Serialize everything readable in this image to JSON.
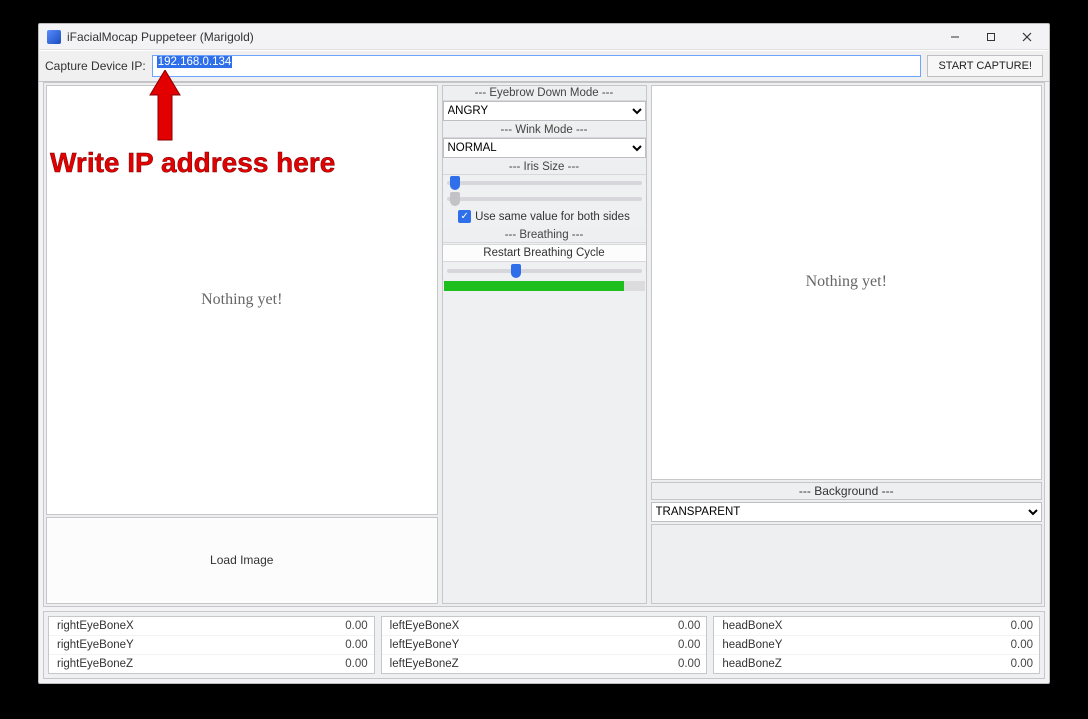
{
  "window": {
    "title": "iFacialMocap Puppeteer (Marigold)"
  },
  "toolbar": {
    "ip_label": "Capture Device IP:",
    "ip_value": "192.168.0.134",
    "start_label": "START CAPTURE!"
  },
  "mid": {
    "eyebrow_label": "--- Eyebrow Down Mode ---",
    "eyebrow_value": "ANGRY",
    "wink_label": "--- Wink Mode ---",
    "wink_value": "NORMAL",
    "iris_label": "--- Iris Size ---",
    "same_value_label": "Use same value for both sides",
    "breathing_label": "--- Breathing ---",
    "restart_label": "Restart Breathing Cycle"
  },
  "panels": {
    "left_preview": "Nothing yet!",
    "right_preview": "Nothing yet!",
    "load_image": "Load Image",
    "background_label": "--- Background ---",
    "background_value": "TRANSPARENT"
  },
  "bones": {
    "col1": [
      {
        "name": "rightEyeBoneX",
        "value": "0.00"
      },
      {
        "name": "rightEyeBoneY",
        "value": "0.00"
      },
      {
        "name": "rightEyeBoneZ",
        "value": "0.00"
      }
    ],
    "col2": [
      {
        "name": "leftEyeBoneX",
        "value": "0.00"
      },
      {
        "name": "leftEyeBoneY",
        "value": "0.00"
      },
      {
        "name": "leftEyeBoneZ",
        "value": "0.00"
      }
    ],
    "col3": [
      {
        "name": "headBoneX",
        "value": "0.00"
      },
      {
        "name": "headBoneY",
        "value": "0.00"
      },
      {
        "name": "headBoneZ",
        "value": "0.00"
      }
    ]
  },
  "annotation": {
    "text": "Write IP address here"
  }
}
